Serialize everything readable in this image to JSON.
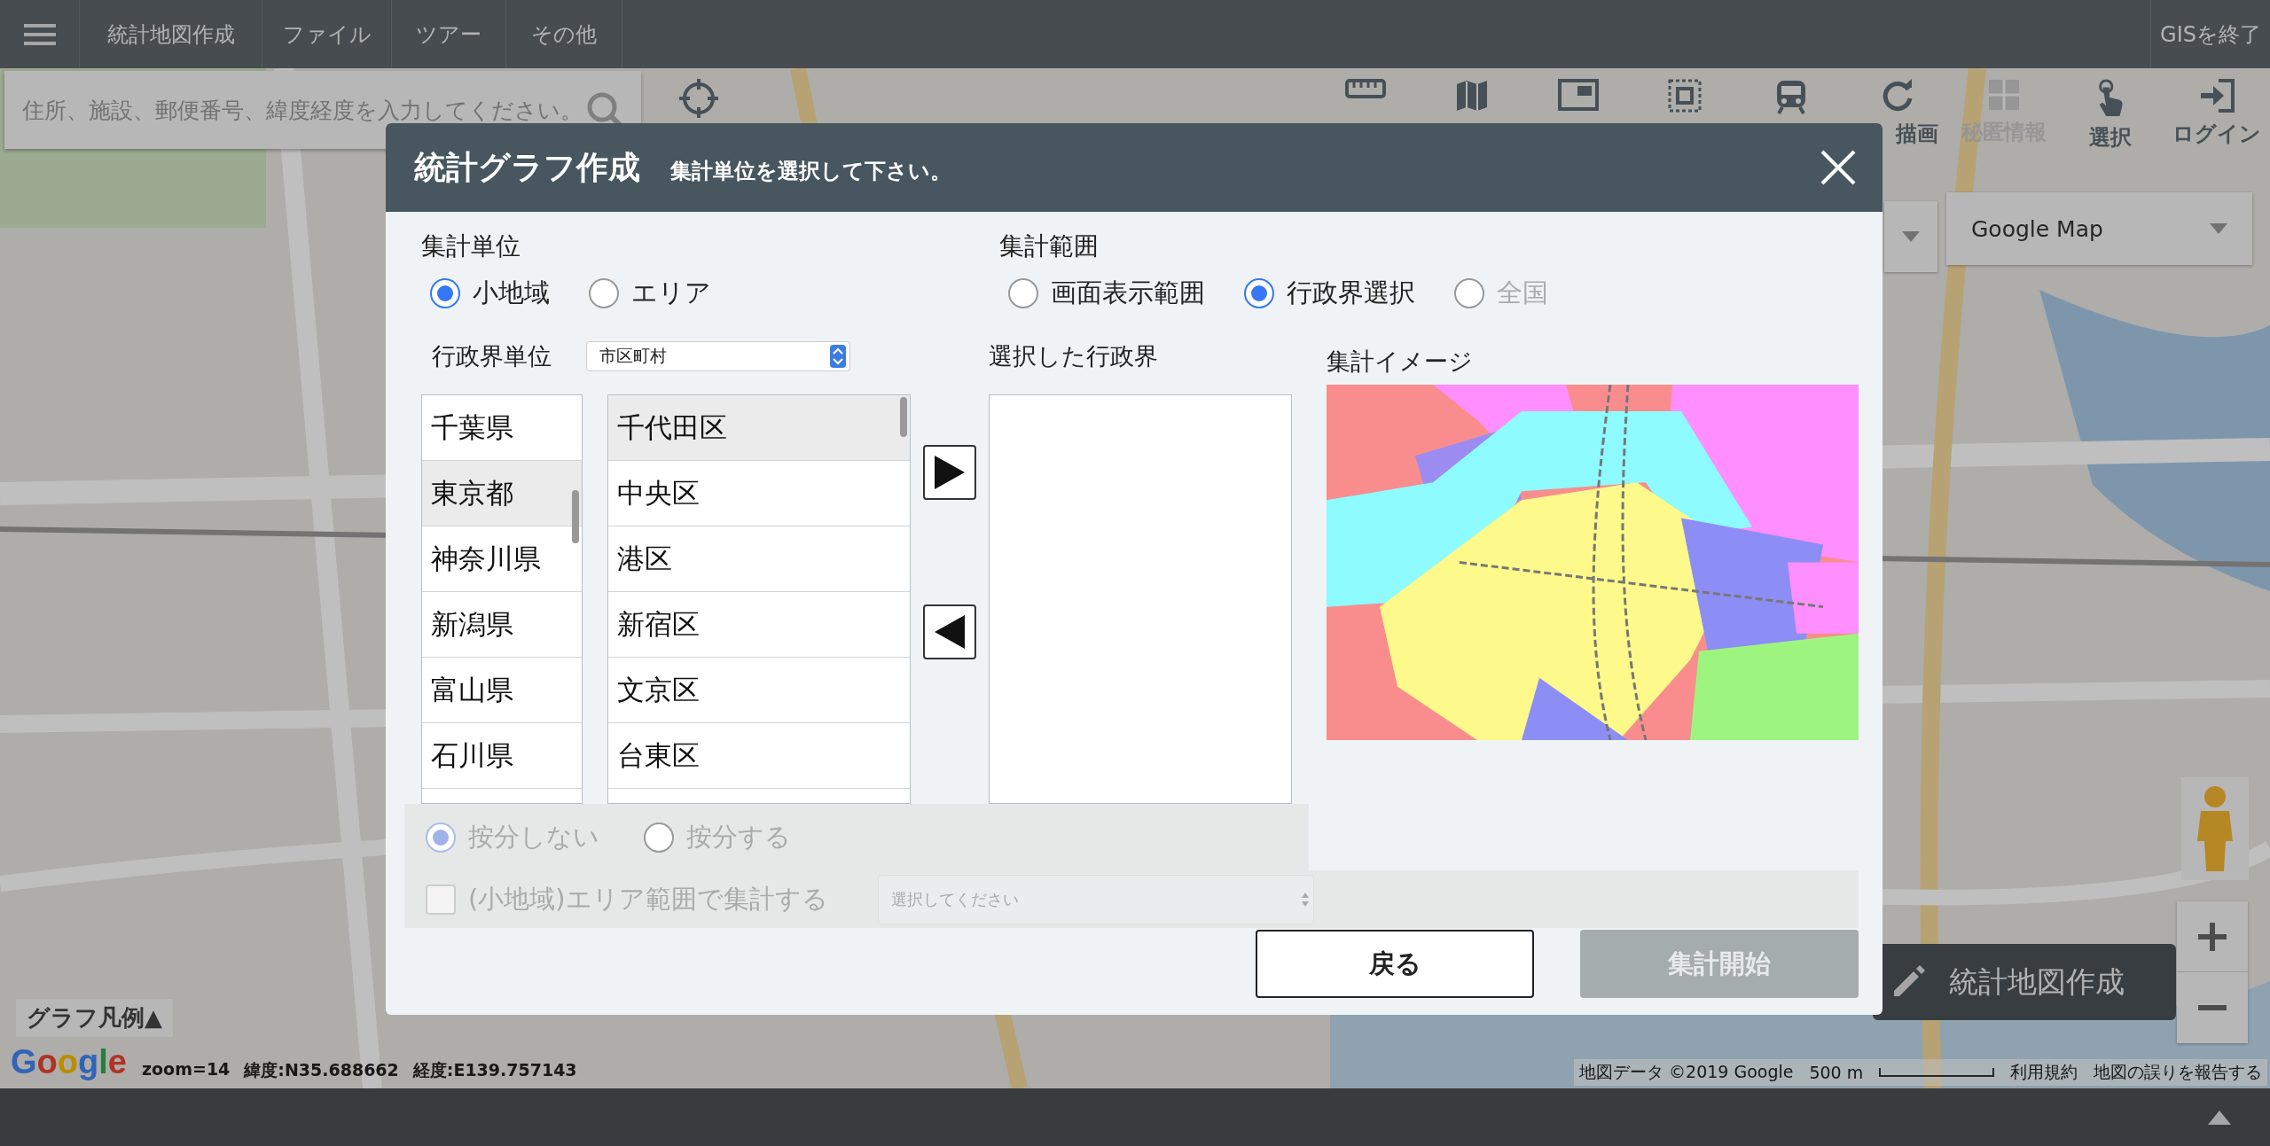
{
  "menu_bar": {
    "items": [
      "統計地図作成",
      "ファイル",
      "ツアー",
      "その他"
    ],
    "exit": "GISを終了"
  },
  "search": {
    "placeholder": "住所、施設、郵便番号、緯度経度を入力してください。"
  },
  "toolbar": [
    {
      "kind": "ruler",
      "disabled": false
    },
    {
      "kind": "map",
      "disabled": false
    },
    {
      "kind": "window",
      "disabled": false
    },
    {
      "kind": "area",
      "disabled": false
    },
    {
      "kind": "train",
      "disabled": false
    },
    {
      "kind": "refresh",
      "label": "描画",
      "disabled": false
    },
    {
      "kind": "secret",
      "label": "秘匿情報",
      "disabled": true
    },
    {
      "kind": "select",
      "label": "選択",
      "disabled": false
    },
    {
      "kind": "login",
      "label": "ログイン",
      "disabled": false
    }
  ],
  "map": {
    "kind": "picture",
    "layer_select": "Google Map",
    "legend_toggle": "グラフ凡例▲",
    "create_button": "統計地図作成"
  },
  "map_info": {
    "logo": "Google",
    "zoom": "zoom=14",
    "lat": "緯度:N35.688662",
    "lng": "経度:E139.757143",
    "attribution": "地図データ ©2019 Google",
    "scale": "500 m",
    "terms": "利用規約",
    "report": "地図の誤りを報告する"
  },
  "dialog": {
    "title": "統計グラフ作成",
    "subtitle": "集計単位を選択して下さい。",
    "unit": {
      "label": "集計単位",
      "options": [
        {
          "label": "小地域",
          "selected": true
        },
        {
          "label": "エリア",
          "selected": false
        }
      ]
    },
    "range": {
      "label": "集計範囲",
      "options": [
        {
          "label": "画面表示範囲",
          "selected": false,
          "disabled": false
        },
        {
          "label": "行政界選択",
          "selected": true,
          "disabled": false
        },
        {
          "label": "全国",
          "selected": false,
          "disabled": true
        }
      ]
    },
    "admin_unit": {
      "label": "行政界単位",
      "value": "市区町村"
    },
    "prefectures": [
      {
        "label": "千葉県",
        "selected": false
      },
      {
        "label": "東京都",
        "selected": true
      },
      {
        "label": "神奈川県",
        "selected": false
      },
      {
        "label": "新潟県",
        "selected": false
      },
      {
        "label": "富山県",
        "selected": false
      },
      {
        "label": "石川県",
        "selected": false
      }
    ],
    "cities": [
      {
        "label": "千代田区",
        "selected": true
      },
      {
        "label": "中央区",
        "selected": false
      },
      {
        "label": "港区",
        "selected": false
      },
      {
        "label": "新宿区",
        "selected": false
      },
      {
        "label": "文京区",
        "selected": false
      },
      {
        "label": "台東区",
        "selected": false
      }
    ],
    "selected_label": "選択した行政界",
    "image_label": "集計イメージ",
    "apportion": {
      "disabled": true,
      "options": [
        {
          "label": "按分しない",
          "selected": true
        },
        {
          "label": "按分する",
          "selected": false
        }
      ]
    },
    "area_check": {
      "label": "(小地域)エリア範囲で集計する",
      "checked": false,
      "disabled": true
    },
    "area_select": {
      "placeholder": "選択してください",
      "disabled": true
    },
    "buttons": [
      {
        "label": "戻る",
        "kind": "secondary",
        "disabled": false
      },
      {
        "label": "集計開始",
        "kind": "primary",
        "disabled": true
      }
    ]
  }
}
